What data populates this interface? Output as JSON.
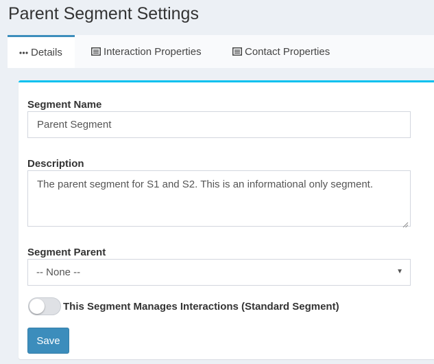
{
  "page": {
    "title": "Parent Segment Settings"
  },
  "tabs": [
    {
      "label": "Details",
      "icon": "ellipsis-icon",
      "active": true
    },
    {
      "label": "Interaction Properties",
      "icon": "list-icon",
      "active": false
    },
    {
      "label": "Contact Properties",
      "icon": "list-icon",
      "active": false
    }
  ],
  "form": {
    "segment_name": {
      "label": "Segment Name",
      "value": "Parent Segment"
    },
    "description": {
      "label": "Description",
      "value": "The parent segment for S1 and S2. This is an informational only segment."
    },
    "segment_parent": {
      "label": "Segment Parent",
      "selected": "-- None --"
    },
    "manages_interactions": {
      "label": "This Segment Manages Interactions (Standard Segment)",
      "on": false
    },
    "save_label": "Save"
  },
  "colors": {
    "accent": "#3c8dbc",
    "card_border": "#00c0ef",
    "background": "#ecf0f5"
  }
}
